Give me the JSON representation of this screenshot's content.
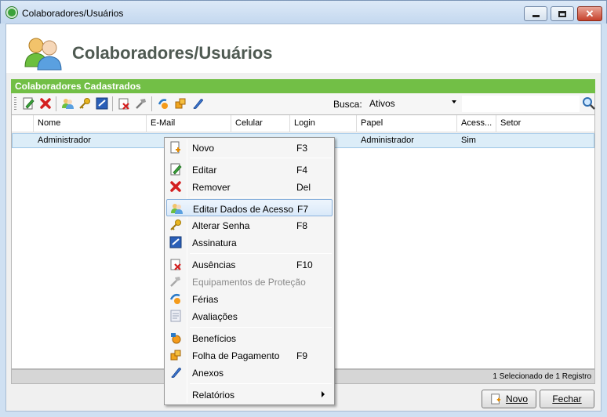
{
  "window": {
    "title": "Colaboradores/Usuários",
    "min_label": "minimize",
    "max_label": "maximize",
    "close_glyph": "✕"
  },
  "header": {
    "title": "Colaboradores/Usuários",
    "icon": "users-icon"
  },
  "section": {
    "title": "Colaboradores Cadastrados"
  },
  "toolbar": {
    "buttons": [
      "new-icon",
      "remove-icon",
      "users-icon",
      "key-icon",
      "signature-icon",
      "absence-icon",
      "tools-icon",
      "vacation-icon",
      "benefits-icon",
      "attachment-icon"
    ],
    "search_label": "Busca:",
    "search_value": "Ativos",
    "search_icon": "magnifier-icon"
  },
  "grid": {
    "columns": [
      "Nome",
      "E-Mail",
      "Celular",
      "Login",
      "Papel",
      "Acess...",
      "Setor"
    ],
    "rows": [
      {
        "nome": "Administrador",
        "email": "",
        "celular": "",
        "login": "",
        "papel": "Administrador",
        "acesso": "Sim",
        "setor": ""
      }
    ]
  },
  "status": {
    "text": "1 Selecionado de 1 Registro"
  },
  "footer": {
    "novo_label": "Novo",
    "fechar_label": "Fechar"
  },
  "context_menu": {
    "items": [
      {
        "label": "Novo",
        "key": "F3",
        "icon": "new-icon"
      },
      {
        "label": "Editar",
        "key": "F4",
        "icon": "edit-icon"
      },
      {
        "label": "Remover",
        "key": "Del",
        "icon": "remove-icon"
      },
      {
        "label": "Editar Dados de Acesso",
        "key": "F7",
        "icon": "users-icon"
      },
      {
        "label": "Alterar Senha",
        "key": "F8",
        "icon": "key-icon"
      },
      {
        "label": "Assinatura",
        "key": "",
        "icon": "signature-icon"
      },
      {
        "label": "Ausências",
        "key": "F10",
        "icon": "absence-icon"
      },
      {
        "label": "Equipamentos de Proteção",
        "key": "",
        "icon": "tools-icon"
      },
      {
        "label": "Férias",
        "key": "",
        "icon": "vacation-icon"
      },
      {
        "label": "Avaliações",
        "key": "",
        "icon": "evaluation-icon"
      },
      {
        "label": "Benefícios",
        "key": "",
        "icon": "benefits-icon"
      },
      {
        "label": "Folha de Pagamento",
        "key": "F9",
        "icon": "payroll-icon"
      },
      {
        "label": "Anexos",
        "key": "",
        "icon": "attachment-icon"
      },
      {
        "label": "Relatórios",
        "key": "",
        "icon": ""
      }
    ]
  },
  "colors": {
    "section_bar": "#72bf46",
    "selected_row": "#dcedf8",
    "header_title": "#4f5a52"
  }
}
